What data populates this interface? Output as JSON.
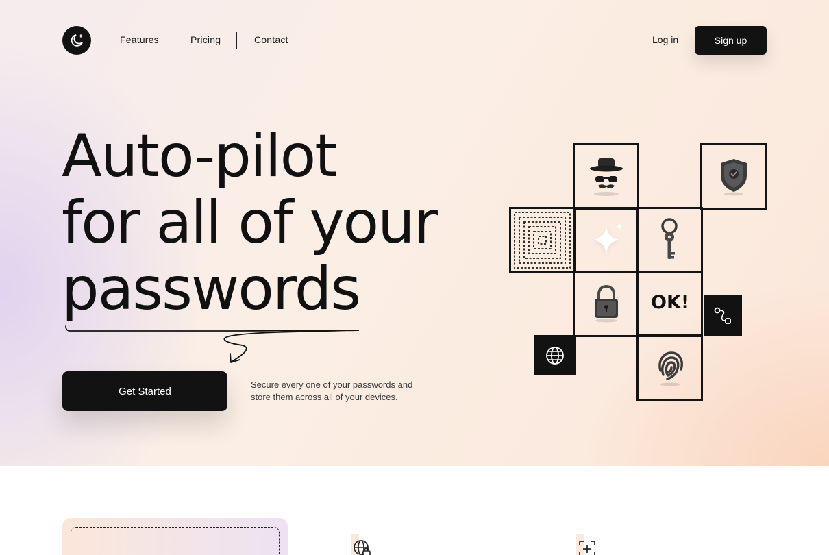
{
  "nav": {
    "links": [
      "Features",
      "Pricing",
      "Contact"
    ],
    "login_label": "Log in",
    "signup_label": "Sign up"
  },
  "hero": {
    "headline_lines": [
      "Auto-pilot",
      "for all of your",
      "passwords"
    ],
    "cta_label": "Get Started",
    "subtext": "Secure every one of your passwords and store them across all of your devices."
  },
  "illustration": {
    "ok_text": "OK!",
    "icons": [
      "incognito-icon",
      "shield-check-icon",
      "concentric-squares-pattern",
      "sparkle-icon",
      "key-icon",
      "padlock-icon",
      "route-icon",
      "globe-icon",
      "fingerprint-icon"
    ]
  },
  "colors": {
    "dark": "#121212",
    "hero_peach": "#fbe7da",
    "hero_lavender": "#ded2f0"
  }
}
